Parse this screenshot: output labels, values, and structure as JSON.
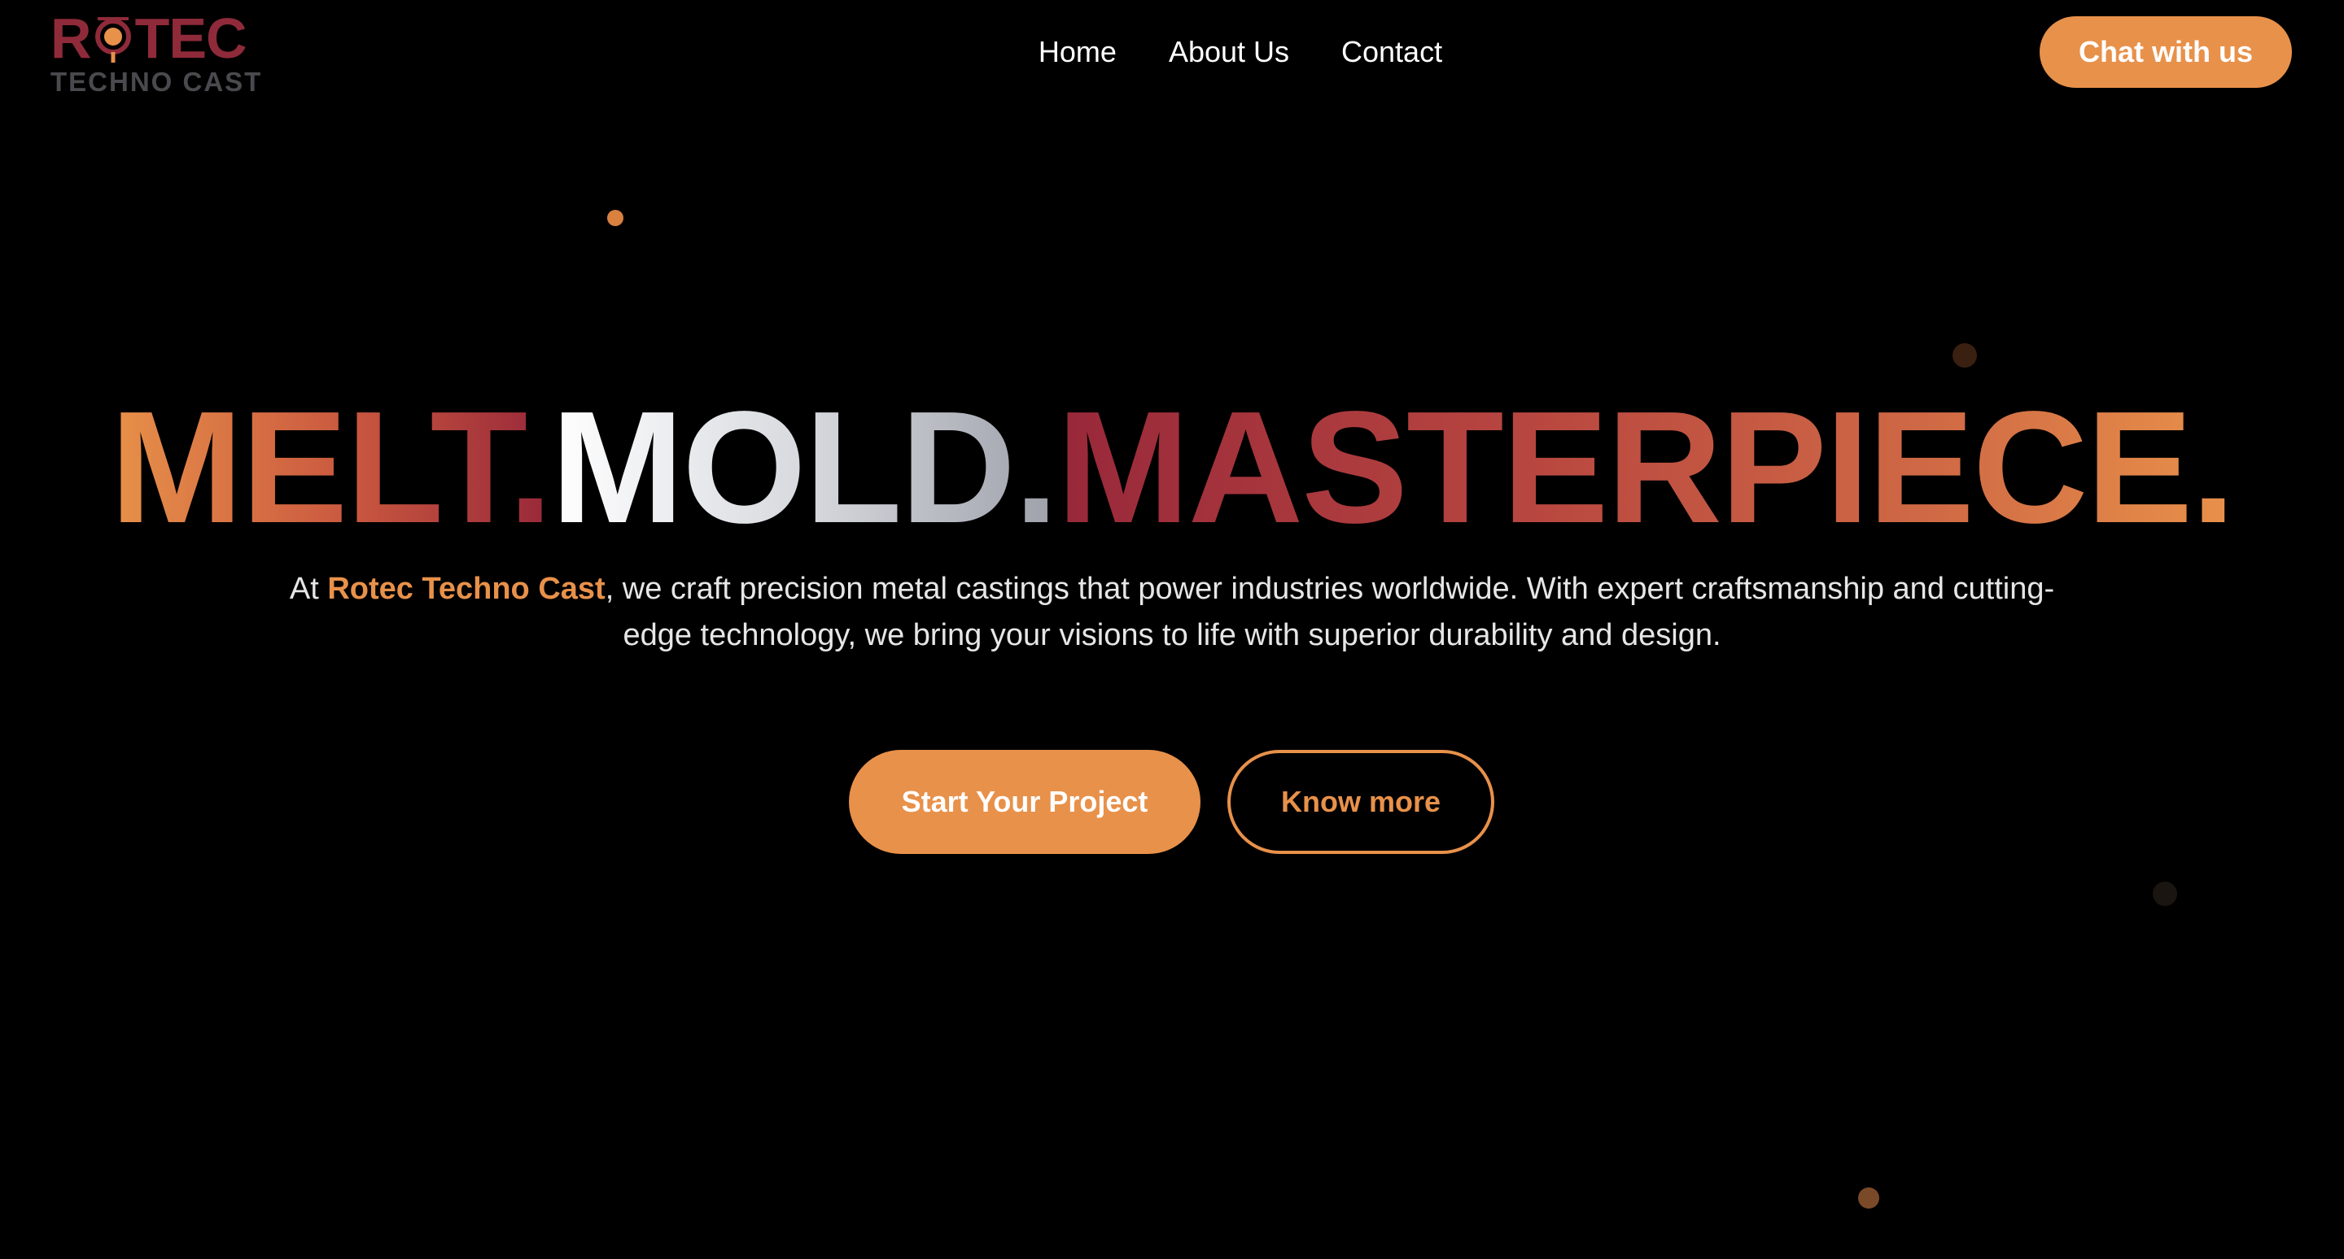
{
  "brand": {
    "logo_word": "ROTEC",
    "logo_word_before": "R",
    "logo_word_after": "TEC",
    "logo_subtitle": "TECHNO CAST",
    "logo_color": "#8f2a3a"
  },
  "nav": {
    "items": [
      {
        "label": "Home"
      },
      {
        "label": "About Us"
      },
      {
        "label": "Contact"
      }
    ]
  },
  "header": {
    "chat_label": "Chat with us"
  },
  "hero": {
    "headline": {
      "word1": "MELT.",
      "word2": "MOLD.",
      "word3": "MASTERPIECE."
    },
    "intro": {
      "prefix": "At ",
      "brand_name": "Rotec Techno Cast",
      "suffix": ", we craft precision metal castings that power industries worldwide. With expert craftsmanship and cutting-edge technology, we bring your visions to life with superior durability and design."
    },
    "primary_cta": "Start Your Project",
    "secondary_cta": "Know more"
  },
  "colors": {
    "accent": "#e8914a",
    "crimson": "#98283a",
    "background": "#000000",
    "text": "#ffffff"
  }
}
